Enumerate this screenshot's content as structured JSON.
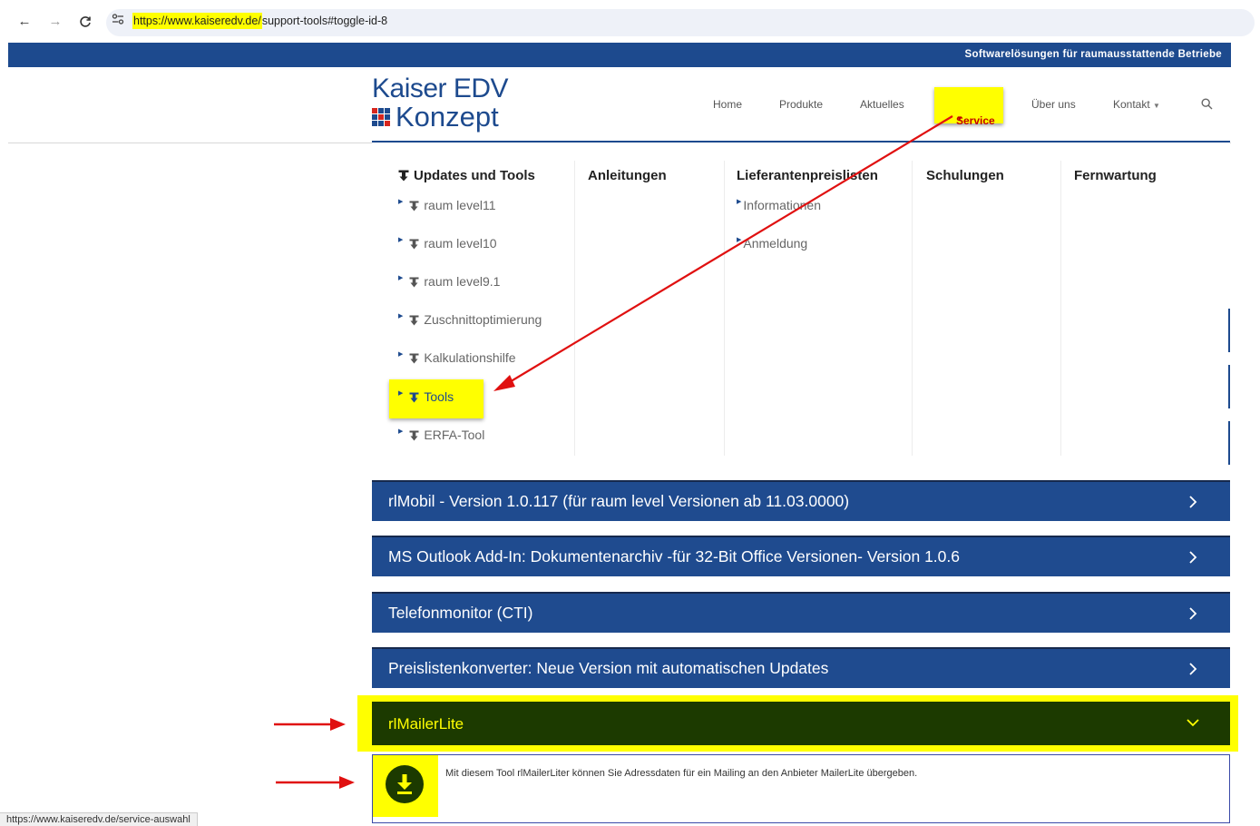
{
  "browser": {
    "back_icon": "back-arrow-icon",
    "forward_icon": "forward-arrow-icon",
    "reload_icon": "reload-icon",
    "url_domain": "https://www.kaiseredv.de/",
    "url_path": "support-tools#toggle-id-8",
    "status_url": "https://www.kaiseredv.de/service-auswahl"
  },
  "site": {
    "tagline": "Softwarelösungen für raumausstattende Betriebe",
    "logo_line1": "Kaiser EDV",
    "logo_line2": "Konzept",
    "nav": {
      "home": "Home",
      "produkte": "Produkte",
      "aktuelles": "Aktuelles",
      "service": "Service",
      "ueber_uns": "Über uns",
      "kontakt": "Kontakt"
    }
  },
  "mega_menu": {
    "columns": [
      {
        "heading": "Updates und Tools",
        "items": [
          "raum level11",
          "raum level10",
          "raum level9.1",
          "Zuschnittoptimierung",
          "Kalkulationshilfe",
          "Tools",
          "ERFA-Tool"
        ]
      },
      {
        "heading": "Anleitungen",
        "items": []
      },
      {
        "heading": "Lieferantenpreislisten",
        "items": [
          "Informationen",
          "Anmeldung"
        ]
      },
      {
        "heading": "Schulungen",
        "items": []
      },
      {
        "heading": "Fernwartung",
        "items": []
      }
    ]
  },
  "accordion": [
    "rlMobil - Version 1.0.117 (für raum level Versionen ab 11.03.0000)",
    "MS Outlook Add-In: Dokumentenarchiv -für 32-Bit Office Versionen- Version 1.0.6",
    "Telefonmonitor (CTI)",
    "Preislistenkonverter: Neue Version mit automatischen Updates",
    "rlMailerLite"
  ],
  "rlmailer_description": "Mit diesem Tool rlMailerLiter können Sie Adressdaten für ein Mailing an den Anbieter MailerLite übergeben.",
  "colors": {
    "brand_blue": "#1d4a8e",
    "highlight_yellow": "#ffff00",
    "annotation_red": "#e01010",
    "active_green": "#1c3a00"
  }
}
